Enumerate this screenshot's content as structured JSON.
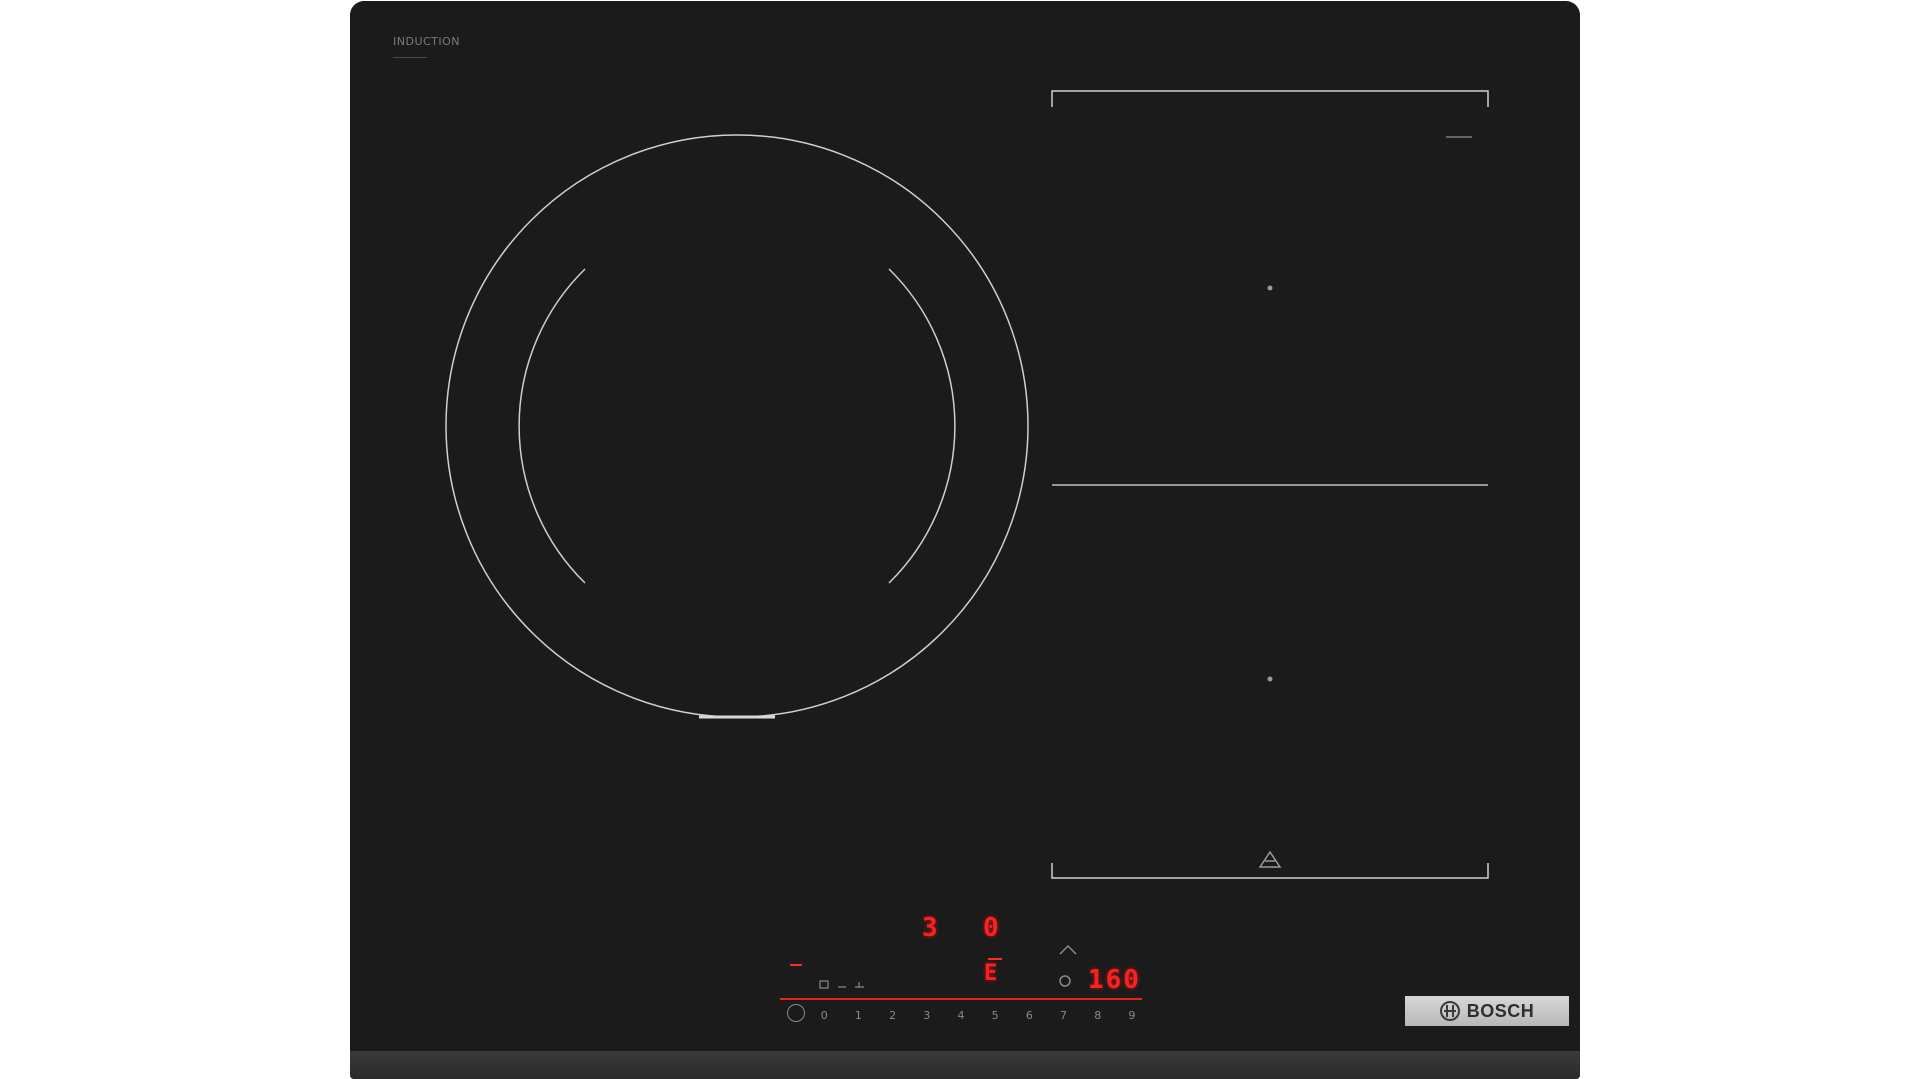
{
  "product": {
    "type_label": "INDUCTION",
    "brand": "BOSCH"
  },
  "display": {
    "zone_level_left": "3",
    "zone_level_mid": "0",
    "timer_readout": "160",
    "small_indicator": "E"
  },
  "controls": {
    "power_symbol": "power-icon",
    "slider_values": [
      "0",
      "1",
      "2",
      "3",
      "4",
      "5",
      "6",
      "7",
      "8",
      "9"
    ]
  },
  "colors": {
    "glass": "#1b1b1b",
    "display_red": "#ff1f1f",
    "zone_outline": "#cfcfcf",
    "badge": "#c8c8c8"
  }
}
